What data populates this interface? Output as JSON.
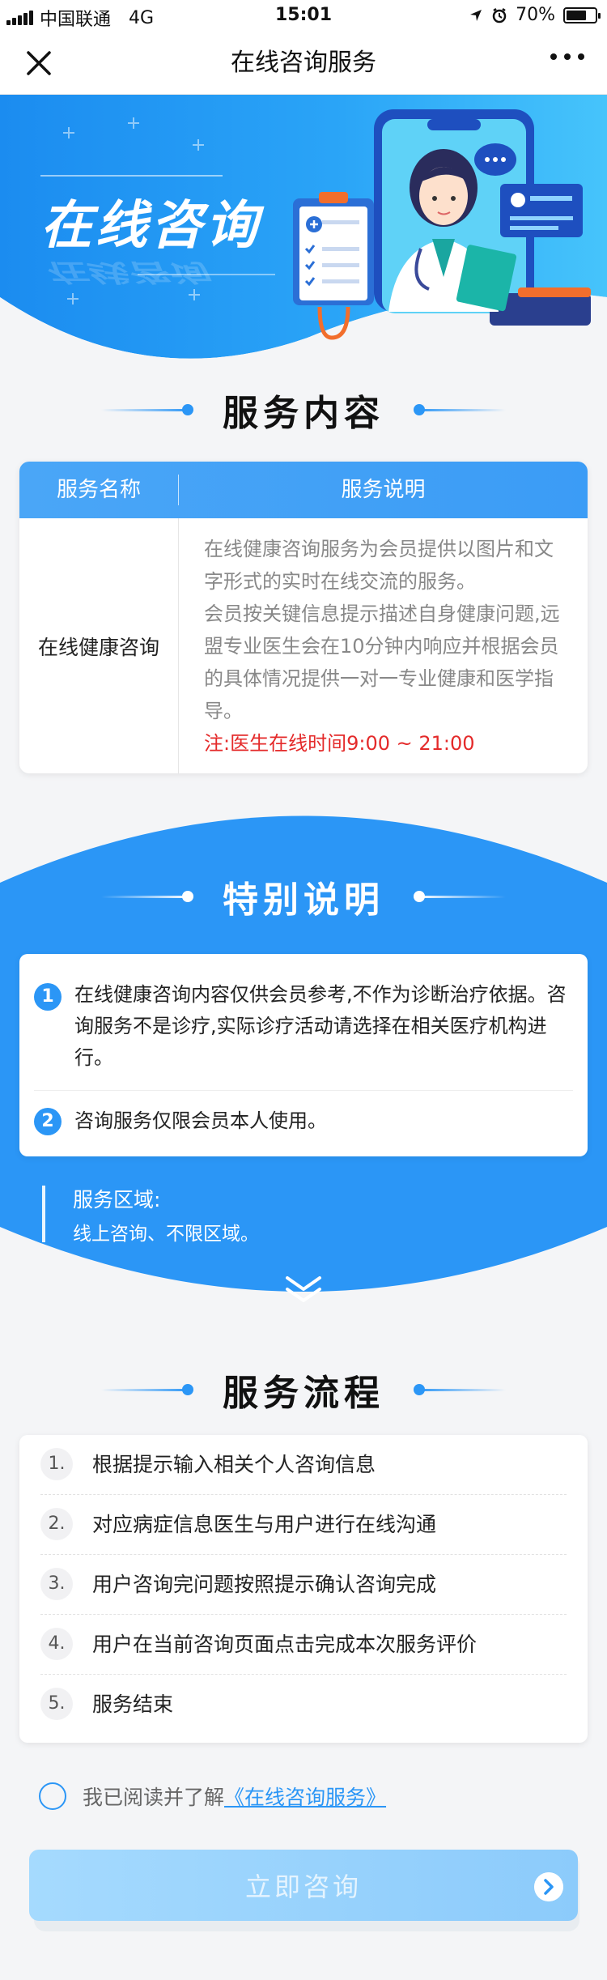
{
  "status_bar": {
    "carrier": "中国联通",
    "network": "4G",
    "time": "15:01",
    "battery": "70%",
    "battery_level": 0.7
  },
  "nav": {
    "title": "在线咨询服务"
  },
  "hero": {
    "title": "在线咨询"
  },
  "service": {
    "heading": "服务内容",
    "col_name": "服务名称",
    "col_desc": "服务说明",
    "name": "在线健康咨询",
    "desc_1": "在线健康咨询服务为会员提供以图片和文字形式的实时在线交流的服务。",
    "desc_2": "会员按关键信息提示描述自身健康问题,远盟专业医生会在10分钟内响应并根据会员的具体情况提供一对一专业健康和医学指导。",
    "note": "注:医生在线时间9:00 ~ 21:00"
  },
  "special": {
    "heading": "特别说明",
    "items": [
      {
        "num": "1",
        "text": "在线健康咨询内容仅供会员参考,不作为诊断治疗依据。咨询服务不是诊疗,实际诊疗活动请选择在相关医疗机构进行。"
      },
      {
        "num": "2",
        "text": "咨询服务仅限会员本人使用。"
      }
    ],
    "region_label": "服务区域:",
    "region_value": "线上咨询、不限区域。"
  },
  "process": {
    "heading": "服务流程",
    "steps": [
      {
        "num": "1.",
        "text": "根据提示输入相关个人咨询信息"
      },
      {
        "num": "2.",
        "text": "对应病症信息医生与用户进行在线沟通"
      },
      {
        "num": "3.",
        "text": "用户咨询完问题按照提示确认咨询完成"
      },
      {
        "num": "4.",
        "text": "用户在当前咨询页面点击完成本次服务评价"
      },
      {
        "num": "5.",
        "text": "服务结束"
      }
    ]
  },
  "agreement": {
    "prefix": "我已阅读并了解",
    "link": "《在线咨询服务》"
  },
  "button": {
    "label": "立即咨询"
  },
  "colors": {
    "primary": "#2b96f6",
    "note_red": "#e42a2a",
    "band_blue": "#2b96f6"
  }
}
